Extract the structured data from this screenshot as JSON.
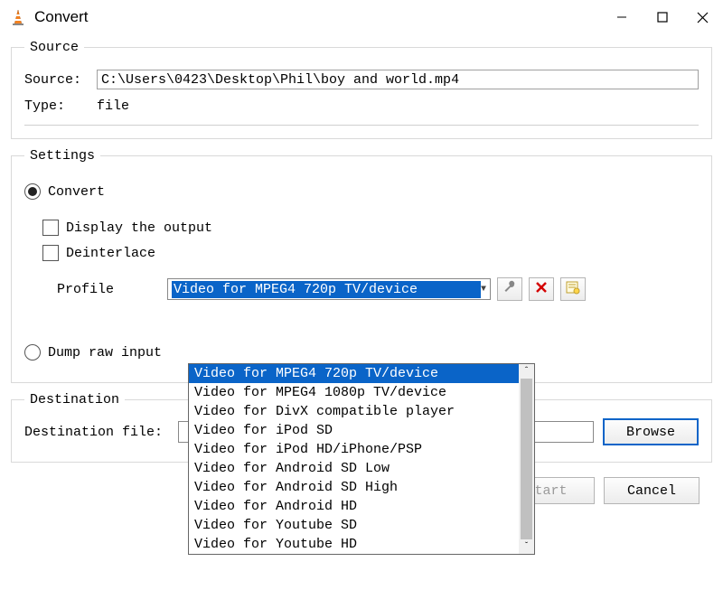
{
  "window": {
    "title": "Convert"
  },
  "source": {
    "legend": "Source",
    "source_label": "Source:",
    "source_value": "C:\\Users\\0423\\Desktop\\Phil\\boy and world.mp4",
    "type_label": "Type:",
    "type_value": "file"
  },
  "settings": {
    "legend": "Settings",
    "convert_label": "Convert",
    "display_output_label": "Display the output",
    "deinterlace_label": "Deinterlace",
    "profile_label": "Profile",
    "profile_selected": "Video for MPEG4 720p TV/device",
    "profile_options": [
      "Video for MPEG4 720p TV/device",
      "Video for MPEG4 1080p TV/device",
      "Video for DivX compatible player",
      "Video for iPod SD",
      "Video for iPod HD/iPhone/PSP",
      "Video for Android SD Low",
      "Video for Android SD High",
      "Video for Android HD",
      "Video for Youtube SD",
      "Video for Youtube HD"
    ],
    "dump_raw_label": "Dump raw input"
  },
  "destination": {
    "legend": "Destination",
    "file_label": "Destination file:",
    "browse_label": "Browse"
  },
  "buttons": {
    "start": "Start",
    "cancel": "Cancel"
  },
  "icons": {
    "wrench": "wrench",
    "delete": "delete",
    "new_profile": "new-profile"
  }
}
